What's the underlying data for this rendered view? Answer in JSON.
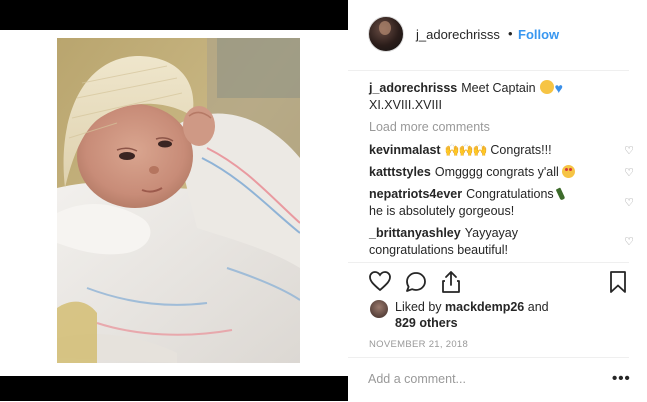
{
  "post": {
    "author": {
      "username": "j_adorechrisss",
      "follow_label": "Follow",
      "separator": "•"
    },
    "image": {
      "alt": "newborn baby in knit hat and hospital blanket"
    },
    "caption": {
      "username": "j_adorechrisss",
      "text": "Meet Captain",
      "line2": "XI.XVIII.XVIII",
      "emojis": [
        "hugging-face-emoji",
        "blue-heart-emoji"
      ]
    },
    "load_more_label": "Load more comments",
    "comments": [
      {
        "username": "kevinmalast",
        "text": "Congrats!!!",
        "emoji": "raised-hands-emoji"
      },
      {
        "username": "katttstyles",
        "text": "Omgggg congrats y'all",
        "emoji": "heart-eyes-emoji"
      },
      {
        "username": "nepatriots4ever",
        "text": "Congratulations",
        "text_line2": "he is absolutely gorgeous!",
        "emoji": "champagne-emoji"
      },
      {
        "username": "_brittanyashley",
        "text": "Yayyayay",
        "text_line2": "congratulations beautiful!"
      }
    ],
    "actions": {
      "like_icon": "heart-outline-icon",
      "comment_icon": "comment-bubble-icon",
      "share_icon": "share-icon",
      "save_icon": "bookmark-icon"
    },
    "likes": {
      "prefix": "Liked by",
      "user": "mackdemp26",
      "conjunction": "and",
      "others": "829 others"
    },
    "date": "NOVEMBER 21, 2018",
    "comment_placeholder": "Add a comment...",
    "more_icon": "ellipsis-icon",
    "more_label": "•••"
  },
  "colors": {
    "link_blue": "#3897f0",
    "muted": "#999999",
    "text": "#262626",
    "border": "#efefef"
  }
}
